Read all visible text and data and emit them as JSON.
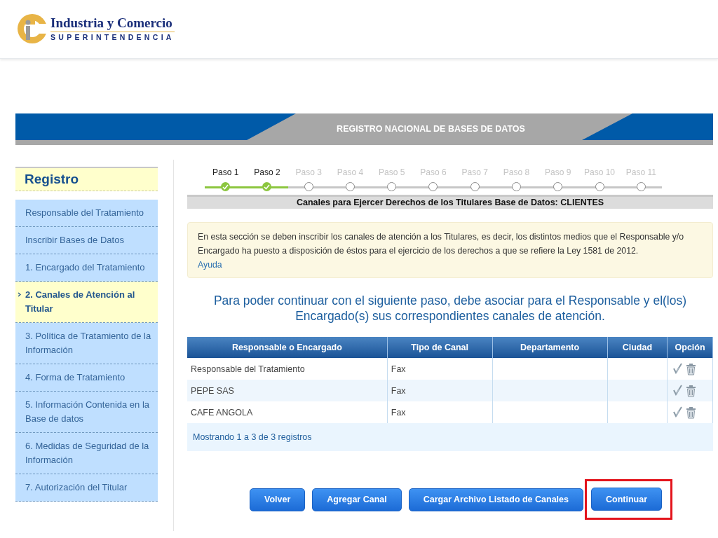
{
  "header": {
    "logo_title": "Industria y Comercio",
    "logo_subtitle": "SUPERINTENDENCIA"
  },
  "banner": {
    "title": "REGISTRO NACIONAL DE BASES DE DATOS"
  },
  "sidebar": {
    "title": "Registro",
    "items": [
      {
        "label": "Responsable del Tratamiento",
        "selected": false
      },
      {
        "label": "Inscribir Bases de Datos",
        "selected": false
      },
      {
        "label": "1. Encargado del Tratamiento",
        "selected": false
      },
      {
        "label": "2. Canales de Atención al Titular",
        "selected": true
      },
      {
        "label": "3. Política de Tratamiento de la Información",
        "selected": false
      },
      {
        "label": "4. Forma de Tratamiento",
        "selected": false
      },
      {
        "label": "5. Información Contenida en la Base de datos",
        "selected": false
      },
      {
        "label": "6. Medidas de Seguridad de la Información",
        "selected": false
      },
      {
        "label": "7. Autorización del Titular",
        "selected": false
      }
    ]
  },
  "steps": [
    {
      "label": "Paso 1",
      "done": true
    },
    {
      "label": "Paso 2",
      "done": true
    },
    {
      "label": "Paso 3",
      "done": false
    },
    {
      "label": "Paso 4",
      "done": false
    },
    {
      "label": "Paso 5",
      "done": false
    },
    {
      "label": "Paso 6",
      "done": false
    },
    {
      "label": "Paso 7",
      "done": false
    },
    {
      "label": "Paso 8",
      "done": false
    },
    {
      "label": "Paso 9",
      "done": false
    },
    {
      "label": "Paso 10",
      "done": false
    },
    {
      "label": "Paso 11",
      "done": false
    }
  ],
  "section_title": "Canales para Ejercer Derechos de los Titulares Base de Datos: CLIENTES",
  "info": {
    "text": "En esta sección se deben inscribir los canales de atención a los Titulares, es decir, los distintos medios que el Responsable y/o Encargado ha puesto a disposición de éstos para el ejercicio de los derechos a que se refiere la Ley 1581 de 2012.",
    "link": "Ayuda"
  },
  "notice": "Para poder continuar con el siguiente paso, debe asociar para el Responsable y el(los) Encargado(s) sus correspondientes canales de atención.",
  "table": {
    "columns": [
      "Responsable o Encargado",
      "Tipo de Canal",
      "Departamento",
      "Ciudad",
      "Opción"
    ],
    "rows": [
      {
        "responsable": "Responsable del Tratamiento",
        "tipo": "Fax"
      },
      {
        "responsable": "PEPE SAS",
        "tipo": "Fax"
      },
      {
        "responsable": "CAFE ANGOLA",
        "tipo": "Fax"
      }
    ],
    "footer": "Mostrando 1 a 3 de 3 registros"
  },
  "buttons": [
    {
      "label": "Volver",
      "highlighted": false
    },
    {
      "label": "Agregar Canal",
      "highlighted": false
    },
    {
      "label": "Cargar Archivo Listado de Canales",
      "highlighted": false
    },
    {
      "label": "Continuar",
      "highlighted": true
    }
  ]
}
